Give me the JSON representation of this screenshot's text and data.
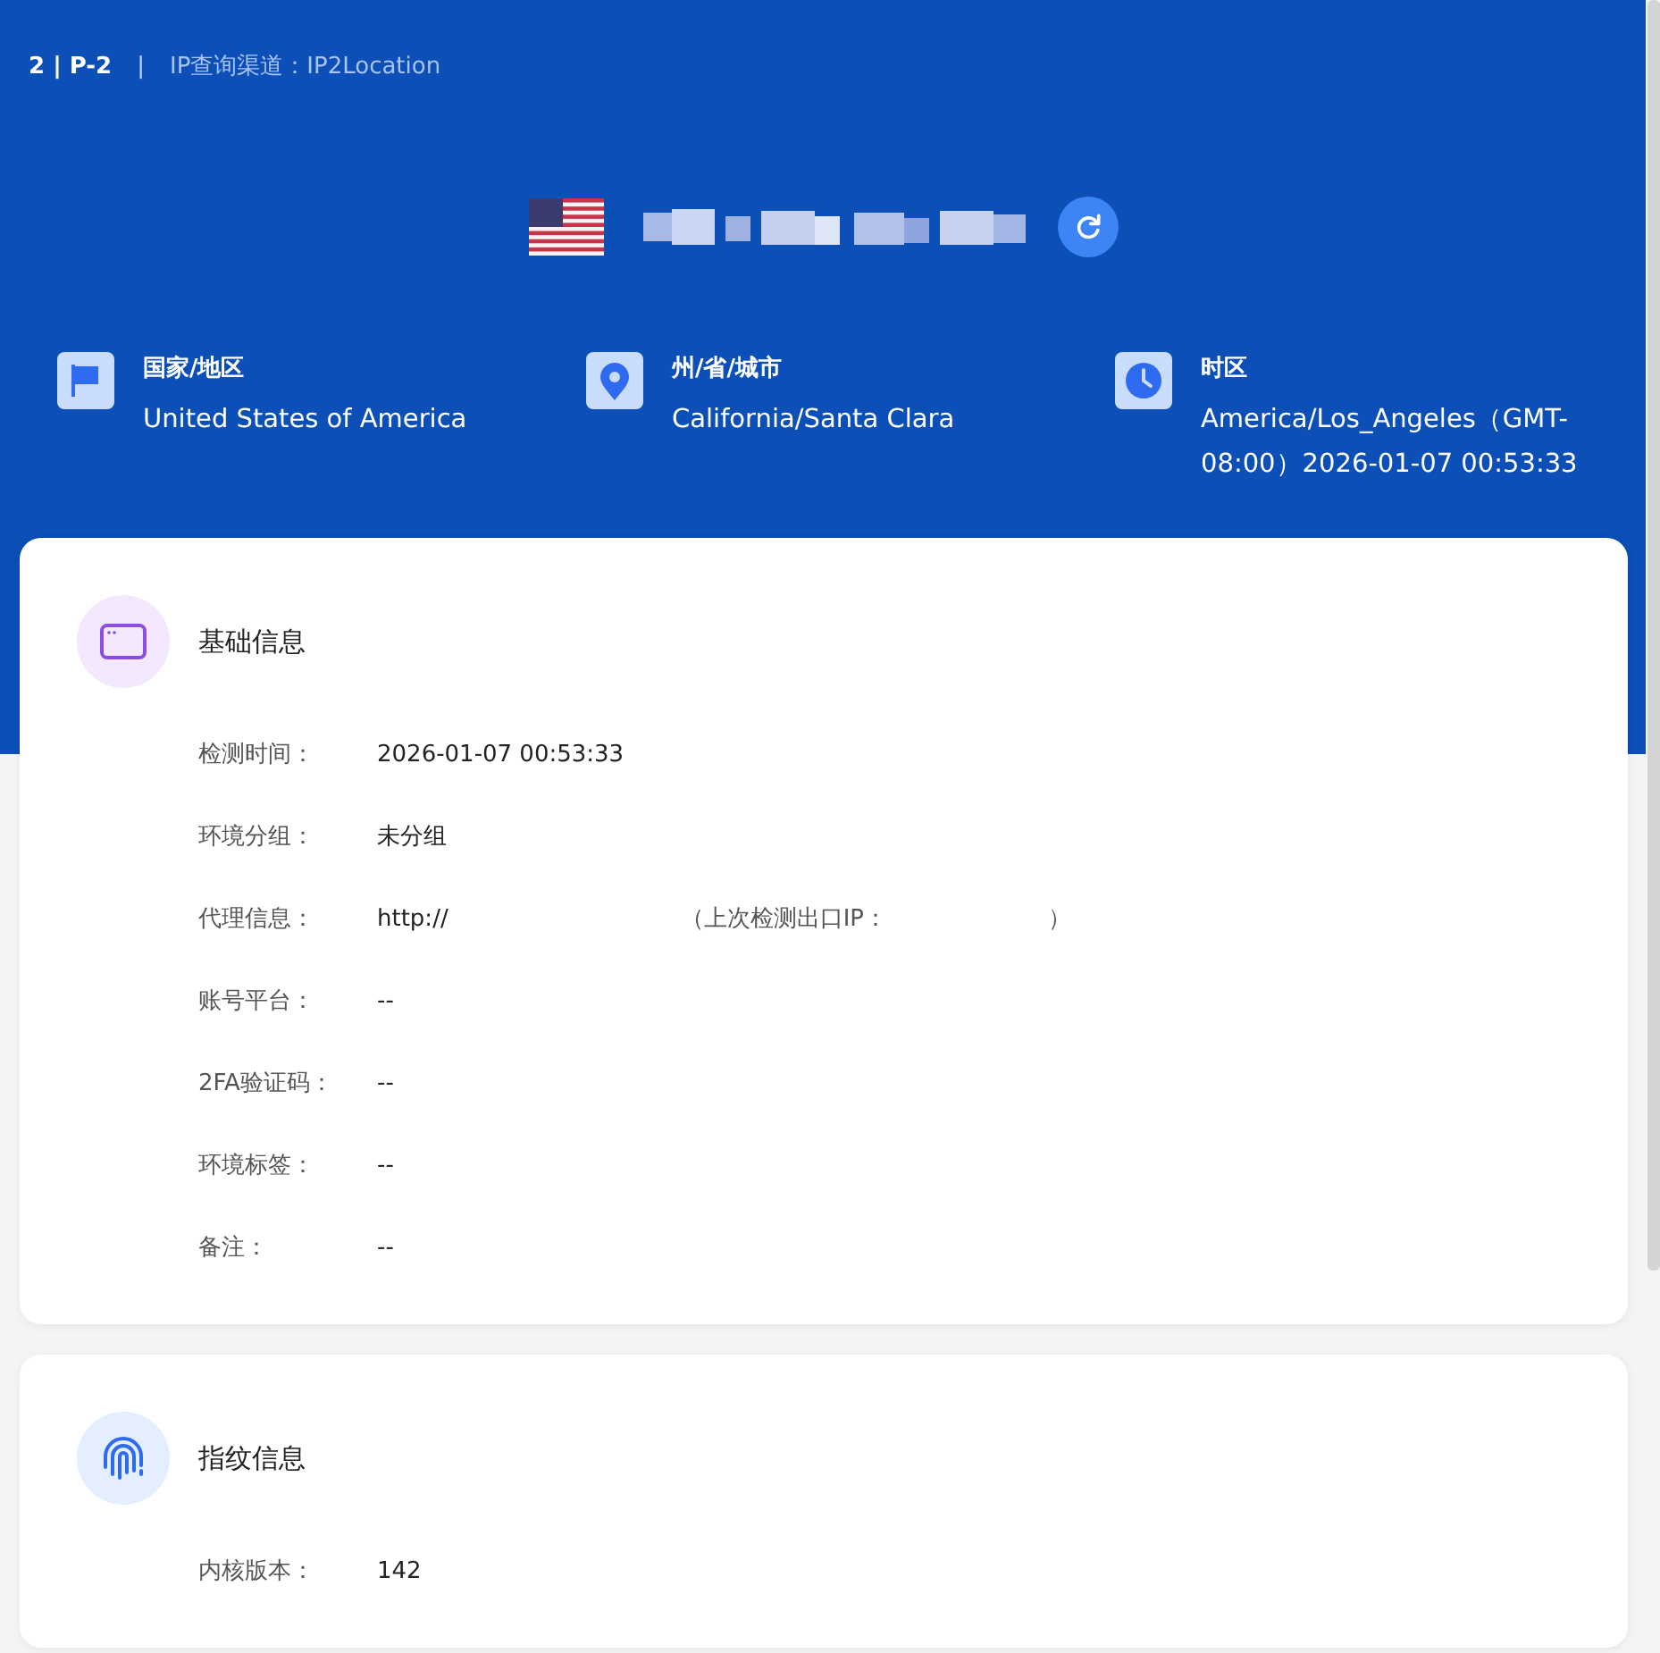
{
  "header": {
    "profile": "2 | P-2",
    "separator": "|",
    "channel": "IP查询渠道：IP2Location",
    "ip": {
      "kind": "redacted"
    },
    "locations": [
      {
        "kind": "flag",
        "label": "国家/地区",
        "value": "United States of America"
      },
      {
        "kind": "pin",
        "label": "州/省/城市",
        "value": "California/Santa Clara"
      },
      {
        "kind": "clock",
        "label": "时区",
        "value": "America/Los_Angeles（GMT-08:00）2026-01-07 00:53:33"
      }
    ]
  },
  "sections": [
    {
      "kind": "window",
      "title": "基础信息",
      "rows": [
        {
          "label": "检测时间：",
          "value": "2026-01-07 00:53:33"
        },
        {
          "label": "环境分组：",
          "value": "未分组"
        },
        {
          "label": "代理信息：",
          "value": "http://",
          "note_open": "（上次检测出口IP：",
          "note_close": "）"
        },
        {
          "label": "账号平台：",
          "value": "--"
        },
        {
          "label": "2FA验证码：",
          "value": "--"
        },
        {
          "label": "环境标签：",
          "value": "--"
        },
        {
          "label": "备注：",
          "value": "--"
        }
      ]
    },
    {
      "kind": "fingerprint",
      "title": "指纹信息",
      "rows": [
        {
          "label": "内核版本：",
          "value": "142"
        }
      ]
    }
  ]
}
